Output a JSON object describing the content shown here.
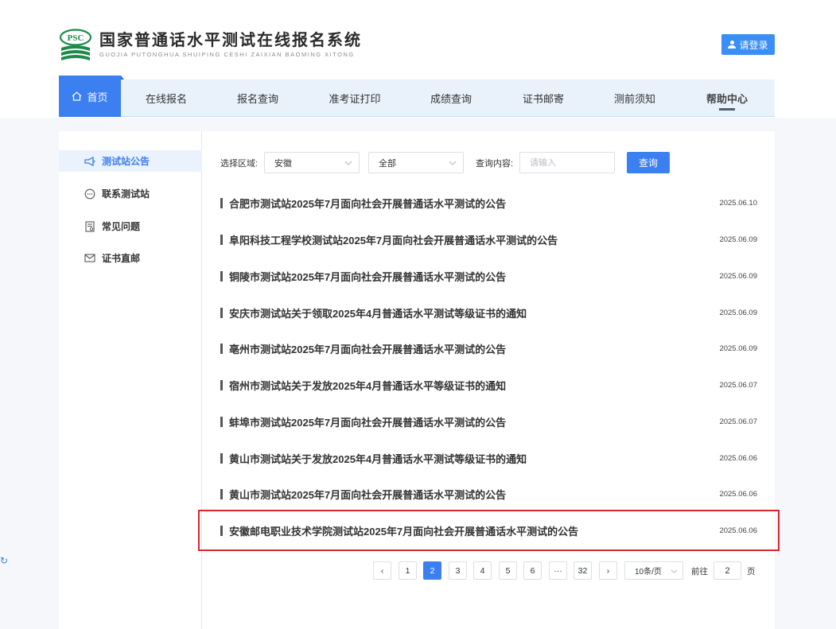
{
  "header": {
    "logo_badge": "PSC",
    "title": "国家普通话水平测试在线报名系统",
    "subtitle": "GUOJIA PUTONGHUA SHUIPING CESHI ZAIXIAN BAOMING XITONG",
    "login_label": "请登录"
  },
  "nav": {
    "items": [
      {
        "label": "首页"
      },
      {
        "label": "在线报名"
      },
      {
        "label": "报名查询"
      },
      {
        "label": "准考证打印"
      },
      {
        "label": "成绩查询"
      },
      {
        "label": "证书邮寄"
      },
      {
        "label": "测前须知"
      },
      {
        "label": "帮助中心"
      }
    ]
  },
  "sidebar": {
    "items": [
      {
        "label": "测试站公告",
        "icon": "megaphone-icon"
      },
      {
        "label": "联系测试站",
        "icon": "chat-icon"
      },
      {
        "label": "常见问题",
        "icon": "document-icon"
      },
      {
        "label": "证书直邮",
        "icon": "mail-icon"
      }
    ]
  },
  "filter": {
    "region_label": "选择区域:",
    "province_value": "安徽",
    "city_value": "全部",
    "content_label": "查询内容:",
    "search_placeholder": "请输入",
    "query_label": "查询"
  },
  "announcements": [
    {
      "title": "合肥市测试站2025年7月面向社会开展普通话水平测试的公告",
      "date": "2025.06.10"
    },
    {
      "title": "阜阳科技工程学校测试站2025年7月面向社会开展普通话水平测试的公告",
      "date": "2025.06.09"
    },
    {
      "title": "铜陵市测试站2025年7月面向社会开展普通话水平测试的公告",
      "date": "2025.06.09"
    },
    {
      "title": "安庆市测试站关于领取2025年4月普通话水平测试等级证书的通知",
      "date": "2025.06.09"
    },
    {
      "title": "亳州市测试站2025年7月面向社会开展普通话水平测试的公告",
      "date": "2025.06.09"
    },
    {
      "title": "宿州市测试站关于发放2025年4月普通话水平等级证书的通知",
      "date": "2025.06.07"
    },
    {
      "title": "蚌埠市测试站2025年7月面向社会开展普通话水平测试的公告",
      "date": "2025.06.07"
    },
    {
      "title": "黄山市测试站关于发放2025年4月普通话水平测试等级证书的通知",
      "date": "2025.06.06"
    },
    {
      "title": "黄山市测试站2025年7月面向社会开展普通话水平测试的公告",
      "date": "2025.06.06"
    },
    {
      "title": "安徽邮电职业技术学院测试站2025年7月面向社会开展普通话水平测试的公告",
      "date": "2025.06.06"
    }
  ],
  "pagination": {
    "prev": "‹",
    "pages": [
      "1",
      "2",
      "3",
      "4",
      "5",
      "6",
      "···",
      "32"
    ],
    "current": "2",
    "next": "›",
    "page_size": "10条/页",
    "goto_label": "前往",
    "goto_value": "2",
    "page_unit": "页"
  },
  "colors": {
    "accent": "#3b7ff0",
    "highlight_border": "#d8262a",
    "logo_green": "#1d8a4b"
  }
}
